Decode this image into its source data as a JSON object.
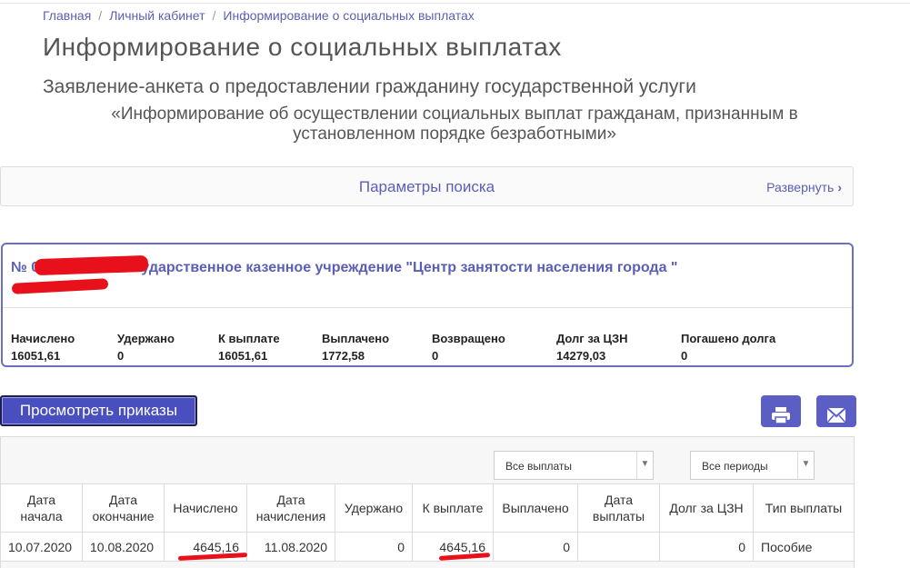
{
  "breadcrumb": [
    "Главная",
    "Личный кабинет",
    "Информирование о социальных выплатах"
  ],
  "page_title": "Информирование о социальных выплатах",
  "subtitle": "Заявление-анкета о предоставлении гражданину государственной услуги",
  "subtitle2": "«Информирование об осуществлении социальных выплат гражданам, признанным в установленном порядке безработными»",
  "search": {
    "title": "Параметры поиска",
    "expand": "Развернуть"
  },
  "record": {
    "title": "№ 09.04.2020 - Государственное казенное учреждение \"Центр занятости населения города \"",
    "stats": [
      {
        "label": "Начислено",
        "value": "16051,61"
      },
      {
        "label": "Удержано",
        "value": "0"
      },
      {
        "label": "К выплате",
        "value": "16051,61"
      },
      {
        "label": "Выплачено",
        "value": "1772,58"
      },
      {
        "label": "Возвращено",
        "value": "0"
      },
      {
        "label": "Долг за ЦЗН",
        "value": "14279,03"
      },
      {
        "label": "Погашено долга",
        "value": "0"
      }
    ]
  },
  "actions": {
    "view_orders": "Просмотреть приказы",
    "print_icon": "print-icon",
    "mail_icon": "envelope-icon"
  },
  "filters": {
    "payments": "Все выплаты",
    "periods": "Все периоды"
  },
  "table": {
    "headers": [
      "Дата начала",
      "Дата окончание",
      "Начислено",
      "Дата начисления",
      "Удержано",
      "К выплате",
      "Выплачено",
      "Дата выплаты",
      "Долг за ЦЗН",
      "Тип выплаты"
    ],
    "rows": [
      [
        "10.07.2020",
        "10.08.2020",
        "4645,16",
        "11.08.2020",
        "0",
        "4645,16",
        "0",
        "",
        "0",
        "Пособие"
      ]
    ]
  },
  "colors": {
    "accent": "#5b5fc4",
    "redaction": "#e8101a"
  }
}
